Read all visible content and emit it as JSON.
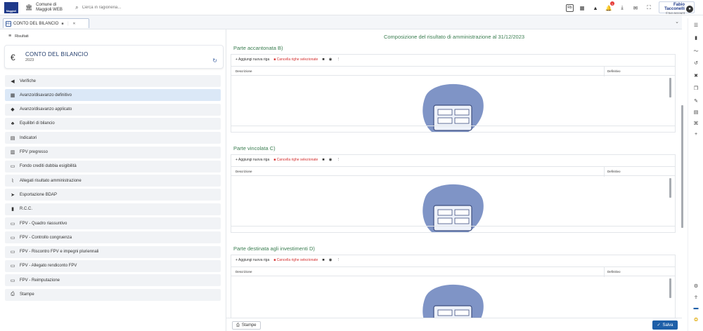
{
  "header": {
    "logo_text": "Maggioli",
    "comune_name": "Comune di Maggioli WEB",
    "search_placeholder": "Cerca in ragioneria...",
    "notification_count": "1",
    "user_name": "Fabio Tacconelli",
    "user_sub": "Il tuo account",
    "app_badge": "Rb"
  },
  "tabs": [
    {
      "label": "CONTO DEL BILANCIO",
      "icon": "Rb"
    }
  ],
  "sidebar": {
    "results_label": "Risultati",
    "card_title": "CONTO DEL BILANCIO",
    "card_year": "2023",
    "items": [
      {
        "label": "Verifiche",
        "icon": "megaphone-icon",
        "glyph": "◀"
      },
      {
        "label": "Avanzo/disavanzo definitivo",
        "icon": "grid-icon",
        "glyph": "▦",
        "active": true
      },
      {
        "label": "Avanzo/disavanzo applicato",
        "icon": "piggy-bank-icon",
        "glyph": "◆"
      },
      {
        "label": "Equilibri di bilancio",
        "icon": "hierarchy-icon",
        "glyph": "♣"
      },
      {
        "label": "Indicatori",
        "icon": "document-chart-icon",
        "glyph": "▤"
      },
      {
        "label": "FPV pregresso",
        "icon": "bank-icon",
        "glyph": "▥"
      },
      {
        "label": "Fondo crediti dubbia esigibilità",
        "icon": "card-icon",
        "glyph": "▭"
      },
      {
        "label": "Allegati risultato amministrazione",
        "icon": "paperclip-icon",
        "glyph": "⌇"
      },
      {
        "label": "Esportazione BDAP",
        "icon": "send-icon",
        "glyph": "➤"
      },
      {
        "label": "R.C.C.",
        "icon": "file-icon",
        "glyph": "▮"
      },
      {
        "label": "FPV - Quadro riassuntivo",
        "icon": "card-icon",
        "glyph": "▭"
      },
      {
        "label": "FPV - Controllo congruenza",
        "icon": "card-icon",
        "glyph": "▭"
      },
      {
        "label": "FPV - Riscontro FPV e impegni pluriennali",
        "icon": "card-icon",
        "glyph": "▭"
      },
      {
        "label": "FPV - Allegato rendiconto FPV",
        "icon": "card-icon",
        "glyph": "▭"
      },
      {
        "label": "FPV - Reimputazione",
        "icon": "card-icon",
        "glyph": "▭"
      },
      {
        "label": "Stampe",
        "icon": "printer-icon",
        "glyph": "⎙"
      }
    ]
  },
  "main": {
    "title": "Composizione del risultato di amministrazione al 31/12/2023",
    "add_row_label": "+ Aggiungi nuova riga",
    "delete_rows_label": "Cancella righe selezionate",
    "col_descrizione": "Descrizione",
    "col_definitivo": "Definitivo",
    "sections": [
      {
        "title": "Parte accantonata B)"
      },
      {
        "title": "Parte vincolata C)"
      },
      {
        "title": "Parte destinata agli investimenti D)"
      }
    ]
  },
  "footer": {
    "stampe_label": "Stampe",
    "salva_label": "Salva"
  },
  "colors": {
    "accent_green": "#3a7d50",
    "primary_blue": "#1e5fa8",
    "danger_red": "#d32f2f",
    "active_item_bg": "#dbe8f7"
  }
}
